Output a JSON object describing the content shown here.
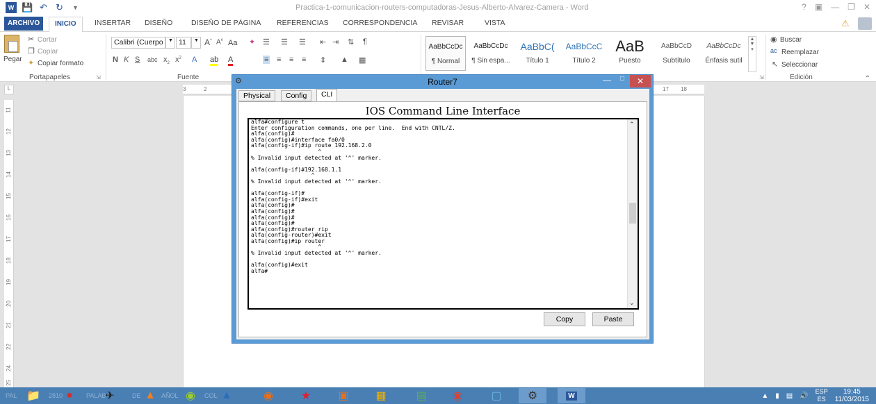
{
  "word": {
    "title": "Practica-1-comunicacion-routers-computadoras-Jesus-Alberto-Alvarez-Camera - Word",
    "title_controls": [
      "?",
      "▣",
      "—",
      "❐",
      "✕"
    ]
  },
  "ribbon_tabs": [
    "ARCHIVO",
    "INICIO",
    "INSERTAR",
    "DISEÑO",
    "DISEÑO DE PÁGINA",
    "REFERENCIAS",
    "CORRESPONDENCIA",
    "REVISAR",
    "VISTA"
  ],
  "clipboard": {
    "paste": "Pegar",
    "cut": "Cortar",
    "copy": "Copiar",
    "format_painter": "Copiar formato",
    "group": "Portapapeles"
  },
  "font": {
    "name": "Calibri (Cuerpo",
    "size": "11",
    "group": "Fuente",
    "change_case": "Aa"
  },
  "styles": [
    {
      "sample": "AaBbCcDc",
      "name": "¶ Normal",
      "selected": true
    },
    {
      "sample": "AaBbCcDc",
      "name": "¶ Sin espa..."
    },
    {
      "sample": "AaBbC(",
      "name": "Título 1"
    },
    {
      "sample": "AaBbCcC",
      "name": "Título 2"
    },
    {
      "sample": "AaB",
      "name": "Puesto"
    },
    {
      "sample": "AaBbCcD",
      "name": "Subtítulo"
    },
    {
      "sample": "AaBbCcDc",
      "name": "Énfasis sutil"
    }
  ],
  "editing": {
    "find": "Buscar",
    "replace": "Reemplazar",
    "select": "Seleccionar",
    "group": "Edición"
  },
  "ruler": {
    "top_left": "3",
    "top_left2": "2",
    "top_right": "17",
    "top_right2": "18",
    "vertical": [
      "11",
      "12",
      "13",
      "14",
      "15",
      "16",
      "17",
      "18",
      "19",
      "20",
      "21",
      "22",
      "24",
      "25"
    ]
  },
  "router": {
    "title": "Router7",
    "tabs": [
      "Physical",
      "Config",
      "CLI"
    ],
    "active_tab": "CLI",
    "heading": "IOS Command Line Interface",
    "lines": [
      "alfa#configure t",
      "Enter configuration commands, one per line.  End with CNTL/Z.",
      "alfa(config)#",
      "alfa(config)#interface fa0/0",
      "alfa(config-if)#ip route 192.168.2.0",
      "                    ^",
      "% Invalid input detected at '^' marker.",
      "",
      "alfa(config-if)#192.168.1.1",
      "                  ^",
      "% Invalid input detected at '^' marker.",
      "",
      "alfa(config-if)#",
      "alfa(config-if)#exit",
      "alfa(config)#",
      "alfa(config)#",
      "alfa(config)#",
      "alfa(config)#",
      "alfa(config)#router rip",
      "alfa(config-router)#exit",
      "alfa(config)#ip router",
      "                    ^",
      "% Invalid input detected at '^' marker.",
      "",
      "alfa(config)#exit",
      "alfa#"
    ],
    "copy_button": "Copy",
    "paste_button": "Paste"
  },
  "taskbar": {
    "ghost_labels": [
      "PAL",
      "2810",
      "PALAB",
      "DE",
      "AÑOL",
      "COL"
    ],
    "lang": "ESP",
    "lang2": "ES",
    "time": "19:45",
    "date": "11/03/2015"
  },
  "colors": {
    "word_blue": "#2b579a",
    "window_frame": "#5a9bd5",
    "taskbar": "#4a7fb4",
    "close_red": "#c75050"
  }
}
